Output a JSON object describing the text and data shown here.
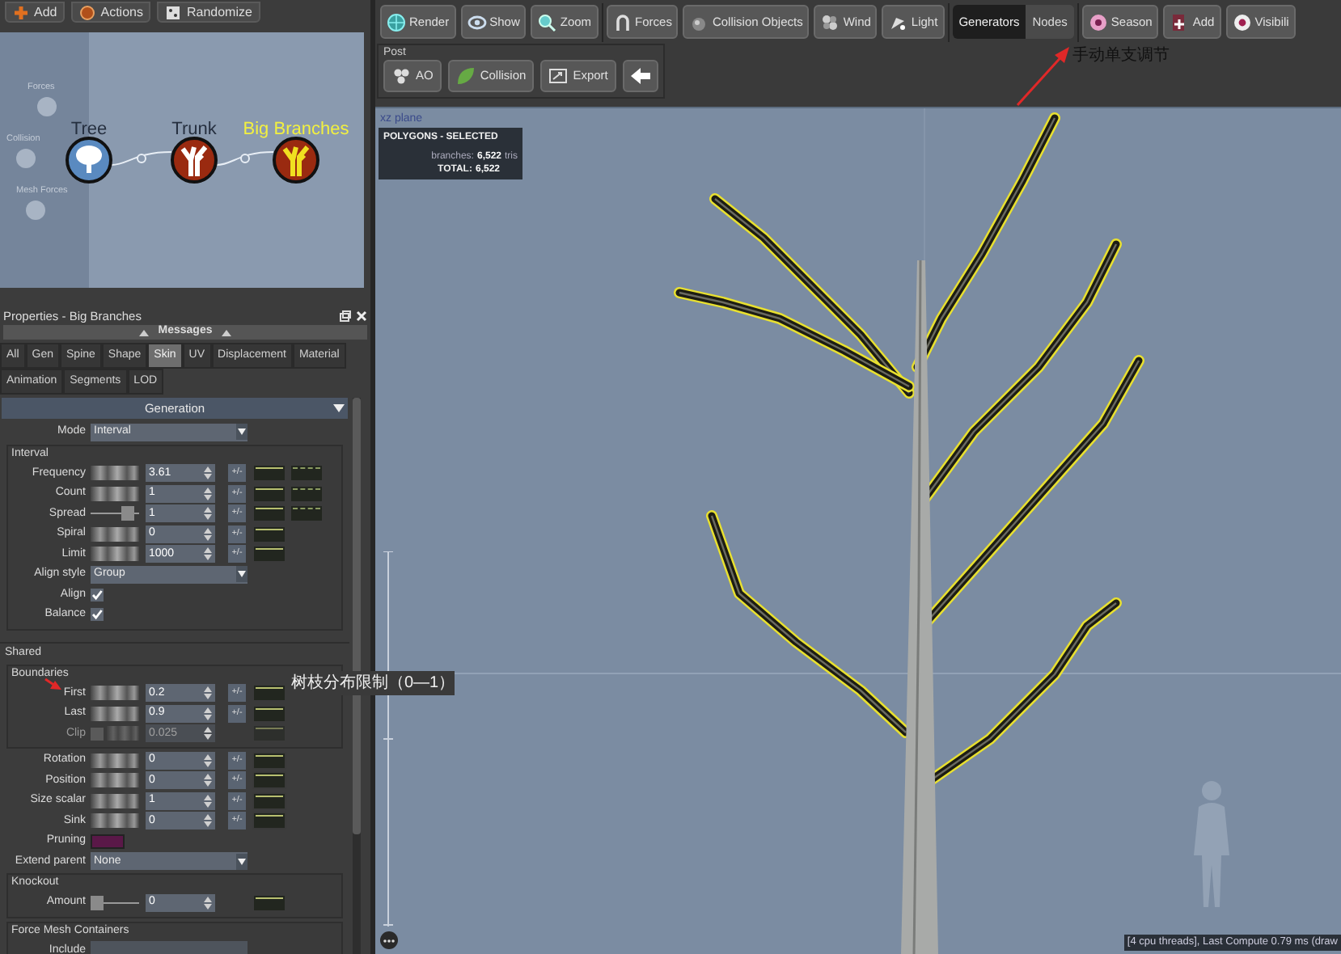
{
  "left_toolbar": {
    "buttons": [
      "Add",
      "Actions",
      "Randomize"
    ]
  },
  "node_graph": {
    "force_items": [
      "Forces",
      "Collision",
      "Mesh Forces"
    ],
    "nodes": [
      {
        "label": "Tree",
        "kind": "tree",
        "selected": false
      },
      {
        "label": "Trunk",
        "kind": "branch",
        "selected": false
      },
      {
        "label": "Big Branches",
        "kind": "branch",
        "selected": true
      }
    ]
  },
  "properties": {
    "title": "Properties - Big Branches",
    "messages": "Messages",
    "tab_rows": [
      [
        {
          "label": "All",
          "selected": false
        },
        {
          "label": "Gen",
          "selected": false
        },
        {
          "label": "Spine",
          "selected": false
        },
        {
          "label": "Shape",
          "selected": false
        },
        {
          "label": "Skin",
          "selected": true
        },
        {
          "label": "UV",
          "selected": false
        },
        {
          "label": "Displacement",
          "selected": false
        },
        {
          "label": "Material",
          "selected": false
        }
      ],
      [
        {
          "label": "Animation",
          "selected": false
        },
        {
          "label": "Segments",
          "selected": false
        },
        {
          "label": "LOD",
          "selected": false
        }
      ]
    ],
    "section_title": "Generation",
    "sections": [
      {
        "items": [
          {
            "kind": "dropdown",
            "label": "Mode",
            "value": "Interval"
          },
          {
            "kind": "group",
            "title": "Interval",
            "items": [
              {
                "kind": "wheel",
                "label": "Frequency",
                "value": "3.61",
                "plus_minus": "+/-",
                "extra_curve": true
              },
              {
                "kind": "wheel",
                "label": "Count",
                "value": "1",
                "plus_minus": "+/-",
                "extra_curve": true
              },
              {
                "kind": "slider",
                "label": "Spread",
                "value": "1",
                "level": 0.85,
                "plus_minus": "+/-",
                "extra_curve": true
              },
              {
                "kind": "wheel",
                "label": "Spiral",
                "value": "0",
                "plus_minus": "+/-",
                "extra_curve": false
              },
              {
                "kind": "wheel",
                "label": "Limit",
                "value": "1000",
                "plus_minus": "+/-",
                "extra_curve": false
              },
              {
                "kind": "dropdown",
                "label": "Align style",
                "value": "Group"
              },
              {
                "kind": "checkbox",
                "label": "Align",
                "checked": true
              },
              {
                "kind": "checkbox",
                "label": "Balance",
                "checked": true
              }
            ]
          }
        ]
      },
      {
        "title": "Shared",
        "items": [
          {
            "kind": "group",
            "title": "Boundaries",
            "items": [
              {
                "kind": "wheel",
                "label": "First",
                "value": "0.2",
                "plus_minus": "+/-",
                "extra_curve": false
              },
              {
                "kind": "wheel",
                "label": "Last",
                "value": "0.9",
                "plus_minus": "+/-",
                "extra_curve": false
              },
              {
                "kind": "wheel",
                "label": "Clip",
                "value": "0.025",
                "checked": false,
                "disabled": true,
                "extra_curve": false
              }
            ]
          },
          {
            "kind": "wheel",
            "label": "Rotation",
            "value": "0",
            "plus_minus": "+/-",
            "extra_curve": false
          },
          {
            "kind": "wheel",
            "label": "Position",
            "value": "0",
            "plus_minus": "+/-",
            "extra_curve": false
          },
          {
            "kind": "wheel",
            "label": "Size scalar",
            "value": "1",
            "plus_minus": "+/-",
            "extra_curve": false
          },
          {
            "kind": "wheel",
            "label": "Sink",
            "value": "0",
            "plus_minus": "+/-",
            "extra_curve": false
          },
          {
            "kind": "swatch",
            "label": "Pruning"
          },
          {
            "kind": "dropdown",
            "label": "Extend parent",
            "value": "None"
          },
          {
            "kind": "group",
            "title": "Knockout",
            "items": [
              {
                "kind": "slider",
                "label": "Amount",
                "value": "0",
                "level": 0,
                "extra_curve": false
              }
            ]
          },
          {
            "kind": "group",
            "title": "Force Mesh Containers",
            "items": [
              {
                "kind": "field",
                "label": "Include"
              }
            ]
          }
        ]
      }
    ]
  },
  "toolbar": {
    "groups": [
      {
        "kind": "buttons",
        "items": [
          {
            "label": "Render"
          },
          {
            "label": "Show"
          },
          {
            "label": "Zoom"
          }
        ]
      },
      {
        "kind": "buttons",
        "items": [
          {
            "label": "Forces"
          },
          {
            "label": "Collision Objects"
          },
          {
            "label": "Wind"
          },
          {
            "label": "Light"
          }
        ]
      },
      {
        "kind": "segmented",
        "items": [
          {
            "label": "Generators",
            "selected": true
          },
          {
            "label": "Nodes",
            "selected": false
          }
        ]
      },
      {
        "kind": "buttons",
        "items": [
          {
            "label": "Season"
          },
          {
            "label": "Add"
          },
          {
            "label": "Visibili"
          }
        ]
      }
    ],
    "post": {
      "title": "Post",
      "buttons": [
        "AO",
        "Collision",
        "Export"
      ]
    }
  },
  "viewport": {
    "plane": "xz plane",
    "stats": {
      "title": "POLYGONS - SELECTED",
      "rows": [
        {
          "label": "branches:",
          "value": "6,522",
          "unit": "tris"
        },
        {
          "label": "TOTAL:",
          "value": "6,522"
        }
      ]
    },
    "status": "[4 cpu threads], Last Compute 0.79 ms (draw"
  },
  "annotations": [
    {
      "text": "手动单支调节"
    },
    {
      "text": "树枝分布限制（0—1）"
    }
  ]
}
